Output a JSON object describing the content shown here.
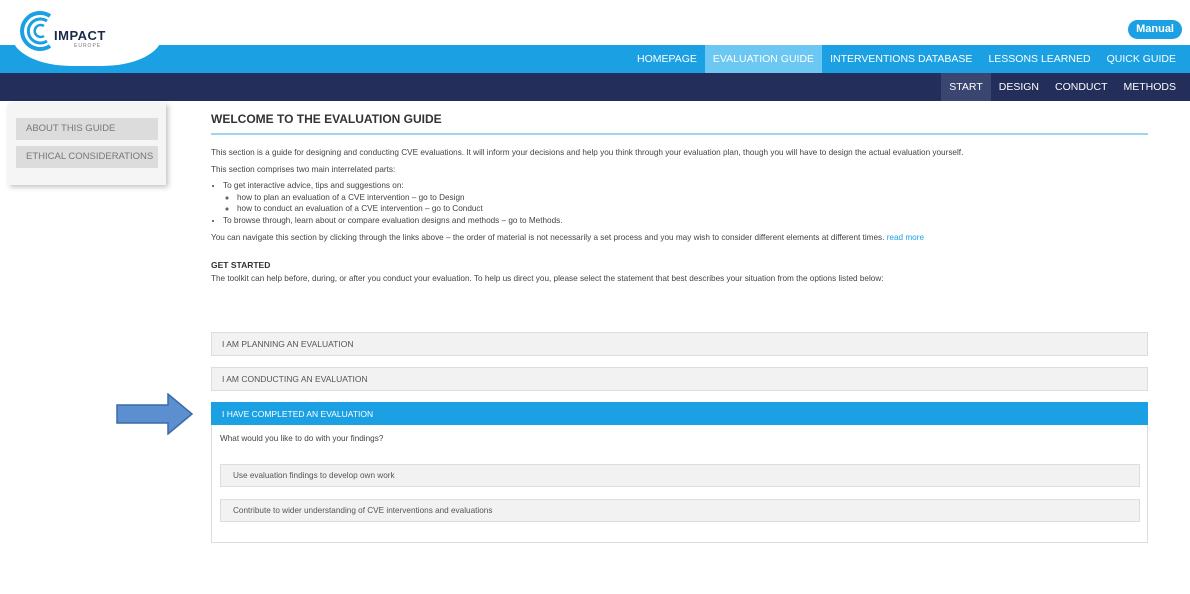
{
  "header": {
    "logo_text": "IMPACT",
    "logo_sub": "EUROPE",
    "manual_label": "Manual"
  },
  "nav_primary": [
    {
      "label": "HOMEPAGE",
      "active": false
    },
    {
      "label": "EVALUATION GUIDE",
      "active": true
    },
    {
      "label": "INTERVENTIONS DATABASE",
      "active": false
    },
    {
      "label": "LESSONS LEARNED",
      "active": false
    },
    {
      "label": "QUICK GUIDE",
      "active": false
    }
  ],
  "nav_secondary": [
    {
      "label": "START",
      "active": true
    },
    {
      "label": "DESIGN",
      "active": false
    },
    {
      "label": "CONDUCT",
      "active": false
    },
    {
      "label": "METHODS",
      "active": false
    }
  ],
  "sidebar": {
    "items": [
      {
        "label": "ABOUT THIS GUIDE"
      },
      {
        "label": "ETHICAL CONSIDERATIONS"
      }
    ]
  },
  "main": {
    "title": "WELCOME TO THE EVALUATION GUIDE",
    "intro": "This section is a guide for designing and conducting CVE evaluations. It will inform your decisions and help you think through your evaluation plan, though you will have to design the actual evaluation yourself.",
    "comprises": "This section comprises two main interrelated parts:",
    "bullet1": "To get interactive advice, tips and suggestions on:",
    "sub1_text": "how to plan an evaluation of a CVE intervention – ",
    "sub1_link": "go to Design",
    "sub2_text": "how to conduct an evaluation of a CVE intervention – ",
    "sub2_link": "go to Conduct",
    "bullet2_text": "To browse through, learn about or compare evaluation designs and methods – ",
    "bullet2_link": "go to Methods",
    "bullet2_end": ".",
    "navigate_text": "You can navigate this section by clicking through the links above – the order of material is not necessarily a set process and you may wish to consider different elements at different times. ",
    "navigate_link": "read more",
    "get_started_heading": "GET STARTED",
    "get_started_text": "The toolkit can help before, during, or after you conduct your evaluation. To help us direct you, please select the statement that best describes your situation from the options listed below:"
  },
  "accordion": {
    "planning": "I AM PLANNING AN EVALUATION",
    "conducting": "I AM CONDUCTING AN EVALUATION",
    "completed": "I HAVE COMPLETED AN EVALUATION",
    "question": "What would you like to do with your findings?",
    "option1": "Use evaluation findings to develop own work",
    "option2": "Contribute to wider understanding of CVE interventions and evaluations"
  },
  "colors": {
    "primary_nav": "#1aa0e3",
    "secondary_nav": "#232e5a",
    "arrow": "#5b8fd0"
  }
}
